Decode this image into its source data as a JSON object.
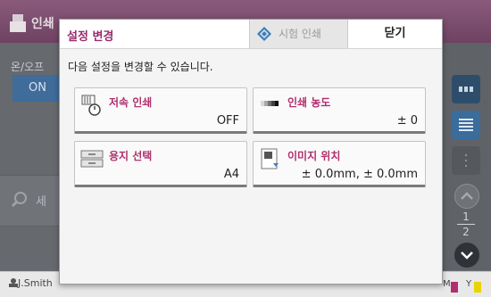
{
  "background": {
    "title": "인쇄",
    "onoff_label": "온/오프",
    "on_button": "ON",
    "search_text": "세",
    "page": {
      "current": "1",
      "total": "2"
    },
    "user": "J.Smith",
    "ink_labels": [
      "M",
      "Y"
    ]
  },
  "dialog": {
    "title": "설정 변경",
    "test_print": "시험 인쇄",
    "close": "닫기",
    "message": "다음 설정을 변경할 수 있습니다.",
    "tiles": [
      {
        "label": "저속 인쇄",
        "value": "OFF",
        "icon": "slow-print-icon"
      },
      {
        "label": "인쇄 농도",
        "value": "± 0",
        "icon": "print-density-icon"
      },
      {
        "label": "용지 선택",
        "value": "A4",
        "icon": "paper-tray-icon"
      },
      {
        "label": "이미지 위치",
        "value": "± 0.0mm, ± 0.0mm",
        "icon": "image-position-icon"
      }
    ]
  },
  "colors": {
    "accent": "#b0306f",
    "header_bar": "#6f4262",
    "on_button": "#3f6c9a"
  }
}
